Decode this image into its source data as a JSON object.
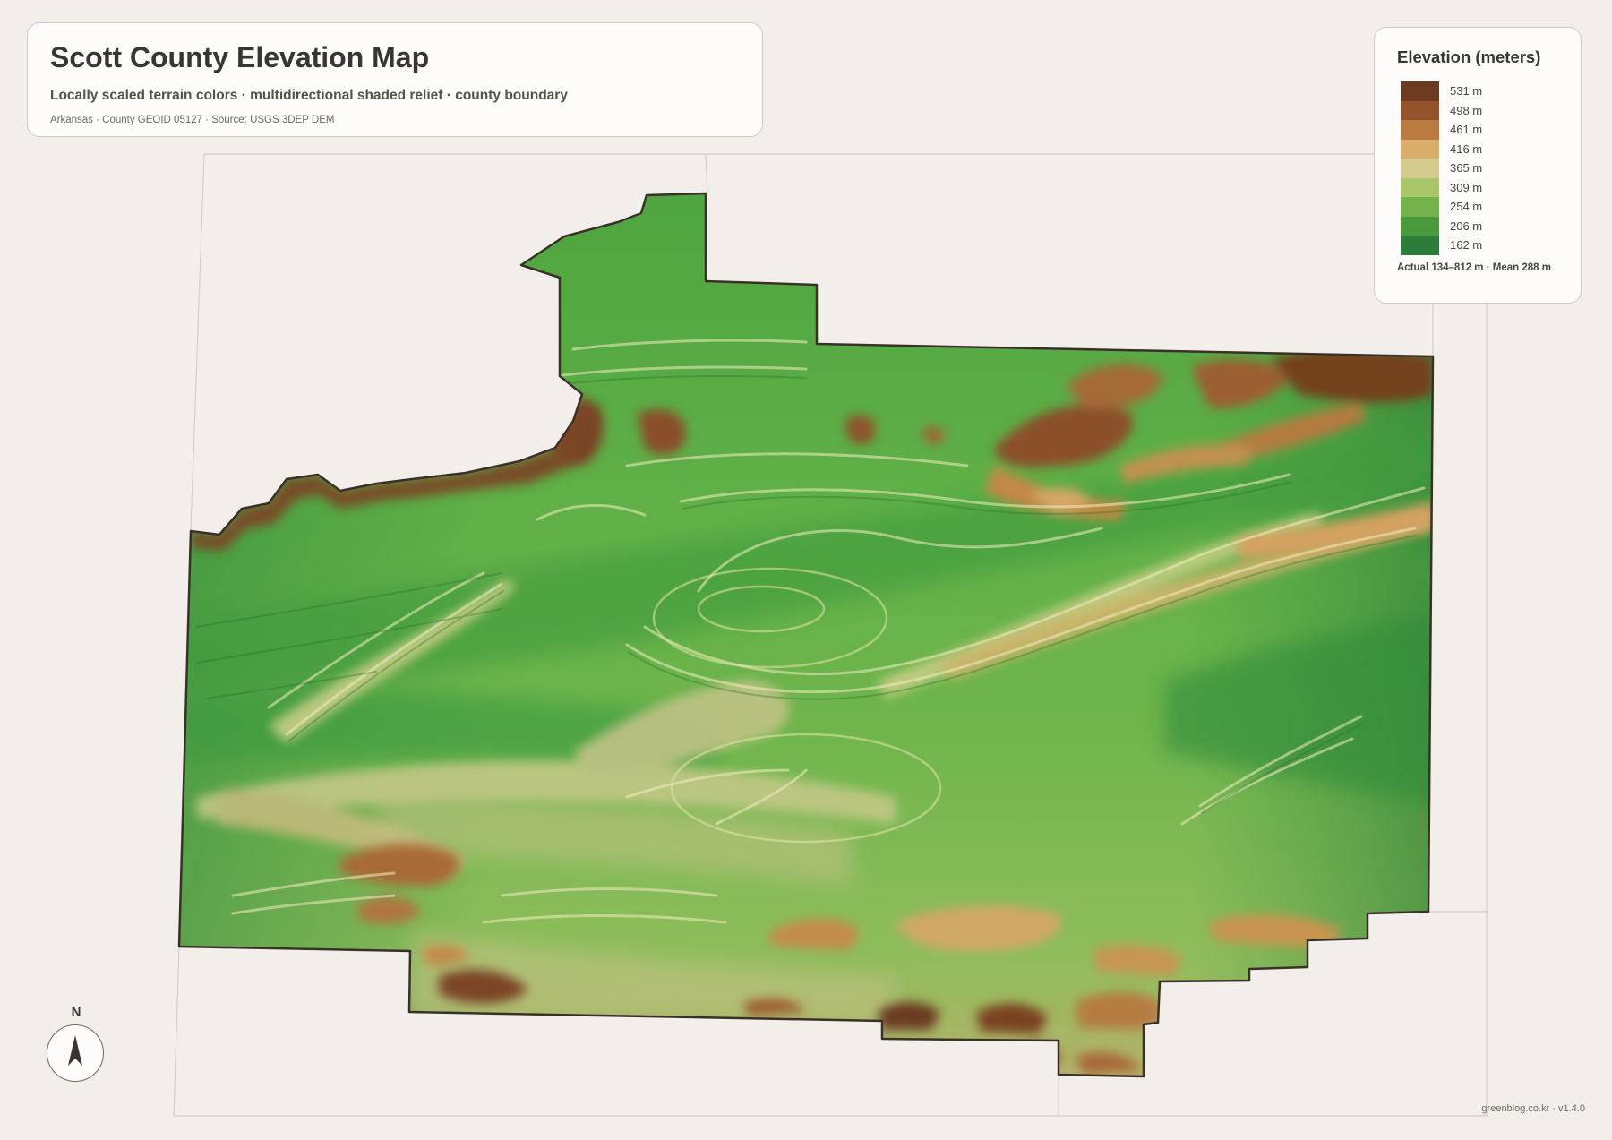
{
  "header": {
    "title": "Scott County Elevation Map",
    "subtitle": "Locally scaled terrain colors · multidirectional shaded relief · county boundary",
    "meta": "Arkansas · County GEOID 05127 · Source: USGS 3DEP DEM"
  },
  "legend": {
    "title": "Elevation (meters)",
    "items": [
      {
        "label": "531 m",
        "color": "#6b3a20"
      },
      {
        "label": "498 m",
        "color": "#94532b"
      },
      {
        "label": "461 m",
        "color": "#bb7b40"
      },
      {
        "label": "416 m",
        "color": "#d8ae6a"
      },
      {
        "label": "365 m",
        "color": "#d3cc8e"
      },
      {
        "label": "309 m",
        "color": "#a9c66a"
      },
      {
        "label": "254 m",
        "color": "#74b24b"
      },
      {
        "label": "206 m",
        "color": "#4a9a3d"
      },
      {
        "label": "162 m",
        "color": "#2d7d3a"
      }
    ],
    "footer": "Actual 134–812 m · Mean 288 m"
  },
  "compass": {
    "label": "N"
  },
  "footer": {
    "credit": "greenblog.co.kr · v1.4.0"
  }
}
